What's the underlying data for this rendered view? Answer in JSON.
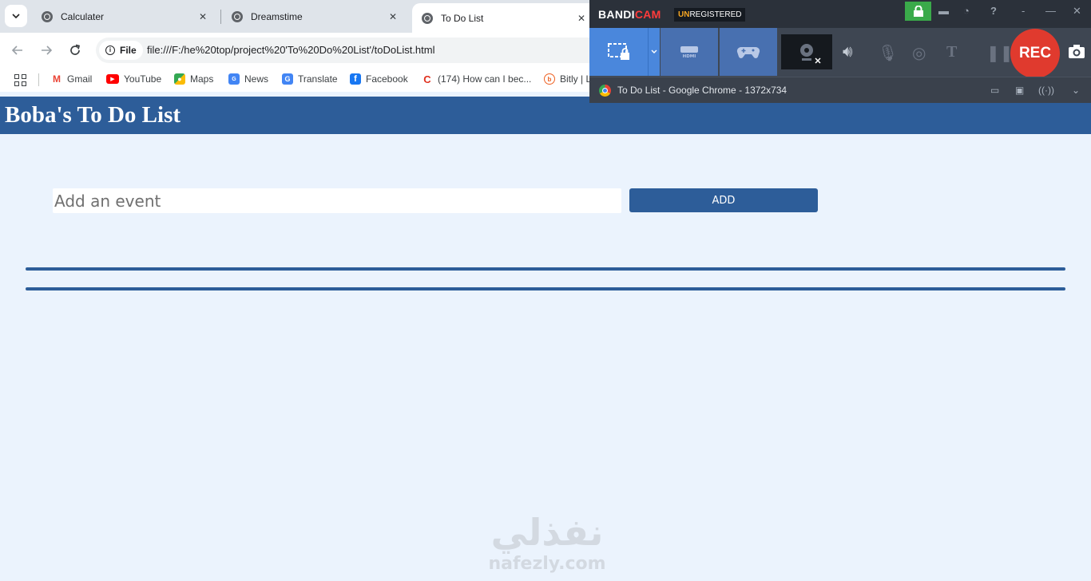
{
  "browser": {
    "tabs": [
      {
        "title": "Calculater"
      },
      {
        "title": "Dreamstime"
      },
      {
        "title": "To Do List"
      }
    ],
    "address": {
      "chip": "File",
      "url": "file:///F:/he%20top/project%20'To%20Do%20List'/toDoList.html"
    },
    "bookmarks": [
      {
        "label": "Gmail",
        "icon": "gmail-icon",
        "color": "#ea4335"
      },
      {
        "label": "YouTube",
        "icon": "youtube-icon",
        "color": "#ff0000"
      },
      {
        "label": "Maps",
        "icon": "maps-icon",
        "color": "#34a853"
      },
      {
        "label": "News",
        "icon": "news-icon",
        "color": "#4285f4"
      },
      {
        "label": "Translate",
        "icon": "translate-icon",
        "color": "#4285f4"
      },
      {
        "label": "Facebook",
        "icon": "facebook-icon",
        "color": "#1877f2"
      },
      {
        "label": "(174) How can I bec...",
        "icon": "quora-icon",
        "color": "#e0301e"
      },
      {
        "label": "Bitly | L",
        "icon": "bitly-icon",
        "color": "#ee6123"
      }
    ]
  },
  "page": {
    "title": "Boba's To Do List",
    "input_placeholder": "Add an event",
    "add_label": "ADD",
    "accent": "#2d5d99",
    "background": "#ebf3fd",
    "watermark": {
      "arabic": "نفذلي",
      "latin": "nafezly.com"
    }
  },
  "bandicam": {
    "brand_main": "BANDI",
    "brand_accent": "CAM",
    "unregistered_prefix": "UN",
    "unregistered_rest": "REGISTERED",
    "rec_label": "REC",
    "target_window": "To Do List - Google Chrome - 1372x734",
    "rec_color": "#e03a2e",
    "mode_color": "#4a87dc"
  }
}
